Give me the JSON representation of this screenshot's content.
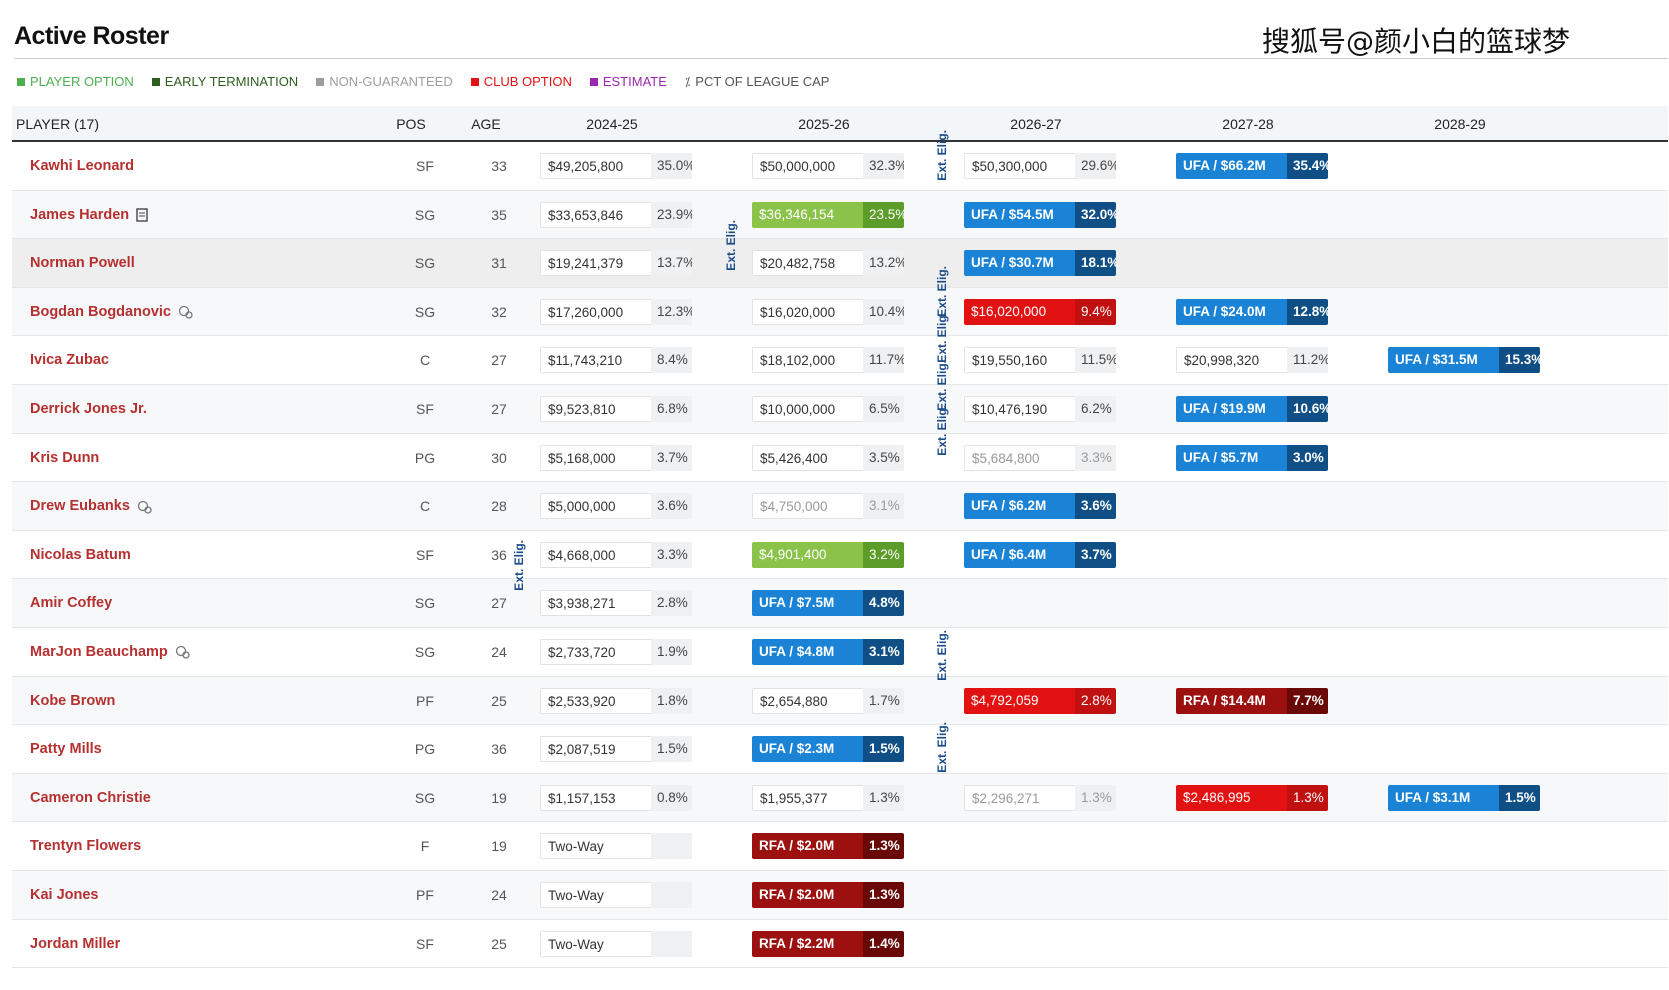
{
  "title": "Active Roster",
  "watermark": "搜狐号@颜小白的篮球梦",
  "legend": [
    {
      "label": "PLAYER OPTION",
      "color": "#4caf50"
    },
    {
      "label": "EARLY TERMINATION",
      "color": "#2e5e1e"
    },
    {
      "label": "NON-GUARANTEED",
      "color": "#9e9e9e"
    },
    {
      "label": "CLUB OPTION",
      "color": "#e31212"
    },
    {
      "label": "ESTIMATE",
      "color": "#9c27b0"
    },
    {
      "label": "PCT OF LEAGUE CAP",
      "color": "#555555"
    }
  ],
  "headers": {
    "player": "PLAYER (17)",
    "pos": "POS",
    "age": "AGE",
    "years": [
      "2024-25",
      "2025-26",
      "2026-27",
      "2027-28",
      "2028-29"
    ]
  },
  "ext_label": "Ext. Elig.",
  "rows": [
    {
      "name": "Kawhi Leonard",
      "pos": "SF",
      "age": "33",
      "cells": [
        [
          "$49,205,800",
          "35.0%",
          ""
        ],
        [
          "$50,000,000",
          "32.3%",
          ""
        ],
        [
          "$50,300,000",
          "29.6%",
          ""
        ],
        [
          "UFA / $66.2M",
          "35.4%",
          "ufa"
        ]
      ]
    },
    {
      "name": "James Harden",
      "pos": "SG",
      "age": "35",
      "icon": "document-icon",
      "cells": [
        [
          "$33,653,846",
          "23.9%",
          ""
        ],
        [
          "$36,346,154",
          "23.5%",
          "green"
        ],
        [
          "UFA / $54.5M",
          "32.0%",
          "ufa"
        ]
      ]
    },
    {
      "name": "Norman Powell",
      "pos": "SG",
      "age": "31",
      "cells": [
        [
          "$19,241,379",
          "13.7%",
          ""
        ],
        [
          "$20,482,758",
          "13.2%",
          ""
        ],
        [
          "UFA / $30.7M",
          "18.1%",
          "ufa"
        ]
      ]
    },
    {
      "name": "Bogdan Bogdanovic",
      "pos": "SG",
      "age": "32",
      "icon": "trade-kicker-icon",
      "cells": [
        [
          "$17,260,000",
          "12.3%",
          ""
        ],
        [
          "$16,020,000",
          "10.4%",
          ""
        ],
        [
          "$16,020,000",
          "9.4%",
          "red"
        ],
        [
          "UFA / $24.0M",
          "12.8%",
          "ufa"
        ]
      ]
    },
    {
      "name": "Ivica Zubac",
      "pos": "C",
      "age": "27",
      "cells": [
        [
          "$11,743,210",
          "8.4%",
          ""
        ],
        [
          "$18,102,000",
          "11.7%",
          ""
        ],
        [
          "$19,550,160",
          "11.5%",
          ""
        ],
        [
          "$20,998,320",
          "11.2%",
          ""
        ],
        [
          "UFA / $31.5M",
          "15.3%",
          "ufa"
        ]
      ]
    },
    {
      "name": "Derrick Jones Jr.",
      "pos": "SF",
      "age": "27",
      "cells": [
        [
          "$9,523,810",
          "6.8%",
          ""
        ],
        [
          "$10,000,000",
          "6.5%",
          ""
        ],
        [
          "$10,476,190",
          "6.2%",
          ""
        ],
        [
          "UFA / $19.9M",
          "10.6%",
          "ufa"
        ]
      ]
    },
    {
      "name": "Kris Dunn",
      "pos": "PG",
      "age": "30",
      "cells": [
        [
          "$5,168,000",
          "3.7%",
          ""
        ],
        [
          "$5,426,400",
          "3.5%",
          ""
        ],
        [
          "$5,684,800",
          "3.3%",
          "faded"
        ],
        [
          "UFA / $5.7M",
          "3.0%",
          "ufa"
        ]
      ]
    },
    {
      "name": "Drew Eubanks",
      "pos": "C",
      "age": "28",
      "icon": "trade-kicker-icon",
      "cells": [
        [
          "$5,000,000",
          "3.6%",
          ""
        ],
        [
          "$4,750,000",
          "3.1%",
          "faded"
        ],
        [
          "UFA / $6.2M",
          "3.6%",
          "ufa"
        ]
      ]
    },
    {
      "name": "Nicolas Batum",
      "pos": "SF",
      "age": "36",
      "cells": [
        [
          "$4,668,000",
          "3.3%",
          ""
        ],
        [
          "$4,901,400",
          "3.2%",
          "green"
        ],
        [
          "UFA / $6.4M",
          "3.7%",
          "ufa"
        ]
      ]
    },
    {
      "name": "Amir Coffey",
      "pos": "SG",
      "age": "27",
      "cells": [
        [
          "$3,938,271",
          "2.8%",
          ""
        ],
        [
          "UFA / $7.5M",
          "4.8%",
          "ufa"
        ]
      ]
    },
    {
      "name": "MarJon Beauchamp",
      "pos": "SG",
      "age": "24",
      "icon": "trade-kicker-icon",
      "cells": [
        [
          "$2,733,720",
          "1.9%",
          ""
        ],
        [
          "UFA / $4.8M",
          "3.1%",
          "ufa"
        ]
      ]
    },
    {
      "name": "Kobe Brown",
      "pos": "PF",
      "age": "25",
      "cells": [
        [
          "$2,533,920",
          "1.8%",
          ""
        ],
        [
          "$2,654,880",
          "1.7%",
          ""
        ],
        [
          "$4,792,059",
          "2.8%",
          "red"
        ],
        [
          "RFA / $14.4M",
          "7.7%",
          "rfa"
        ]
      ]
    },
    {
      "name": "Patty Mills",
      "pos": "PG",
      "age": "36",
      "cells": [
        [
          "$2,087,519",
          "1.5%",
          ""
        ],
        [
          "UFA / $2.3M",
          "1.5%",
          "ufa"
        ]
      ]
    },
    {
      "name": "Cameron Christie",
      "pos": "SG",
      "age": "19",
      "cells": [
        [
          "$1,157,153",
          "0.8%",
          ""
        ],
        [
          "$1,955,377",
          "1.3%",
          ""
        ],
        [
          "$2,296,271",
          "1.3%",
          "faded"
        ],
        [
          "$2,486,995",
          "1.3%",
          "red"
        ],
        [
          "UFA / $3.1M",
          "1.5%",
          "ufa"
        ]
      ]
    },
    {
      "name": "Trentyn Flowers",
      "pos": "F",
      "age": "19",
      "cells": [
        [
          "Two-Way",
          "",
          ""
        ],
        [
          "RFA / $2.0M",
          "1.3%",
          "rfa"
        ]
      ]
    },
    {
      "name": "Kai Jones",
      "pos": "PF",
      "age": "24",
      "cells": [
        [
          "Two-Way",
          "",
          ""
        ],
        [
          "RFA / $2.0M",
          "1.3%",
          "rfa"
        ]
      ]
    },
    {
      "name": "Jordan Miller",
      "pos": "SF",
      "age": "25",
      "cells": [
        [
          "Two-Way",
          "",
          ""
        ],
        [
          "RFA / $2.2M",
          "1.4%",
          "rfa"
        ]
      ]
    }
  ]
}
